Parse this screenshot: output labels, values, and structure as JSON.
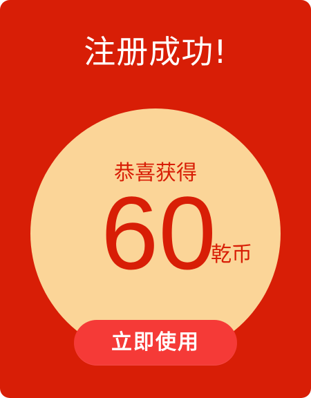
{
  "colors": {
    "card_background": "#d81e06",
    "circle_background": "#fbd598",
    "accent_text": "#d81e06",
    "button_background": "#f53a37",
    "button_text": "#ffffff"
  },
  "dialog": {
    "title": "注册成功!",
    "reward": {
      "congrats_label": "恭喜获得",
      "amount": "60",
      "unit": "乾币"
    },
    "action_button_label": "立即使用"
  }
}
